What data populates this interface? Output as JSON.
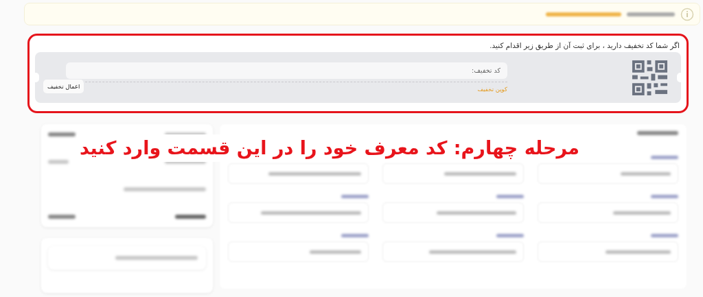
{
  "coupon": {
    "intro": "اگر شما کد تخفیف دارید ، برای ثبت آن از طریق زیر اقدام کنید.",
    "placeholder": "کد تخفیف:",
    "link": "کوپن تخفیف",
    "button": "اعمال تخفیف"
  },
  "annotation": {
    "text": "مرحله چهارم: کد معرف خود را در این قسمت وارد کنید"
  }
}
